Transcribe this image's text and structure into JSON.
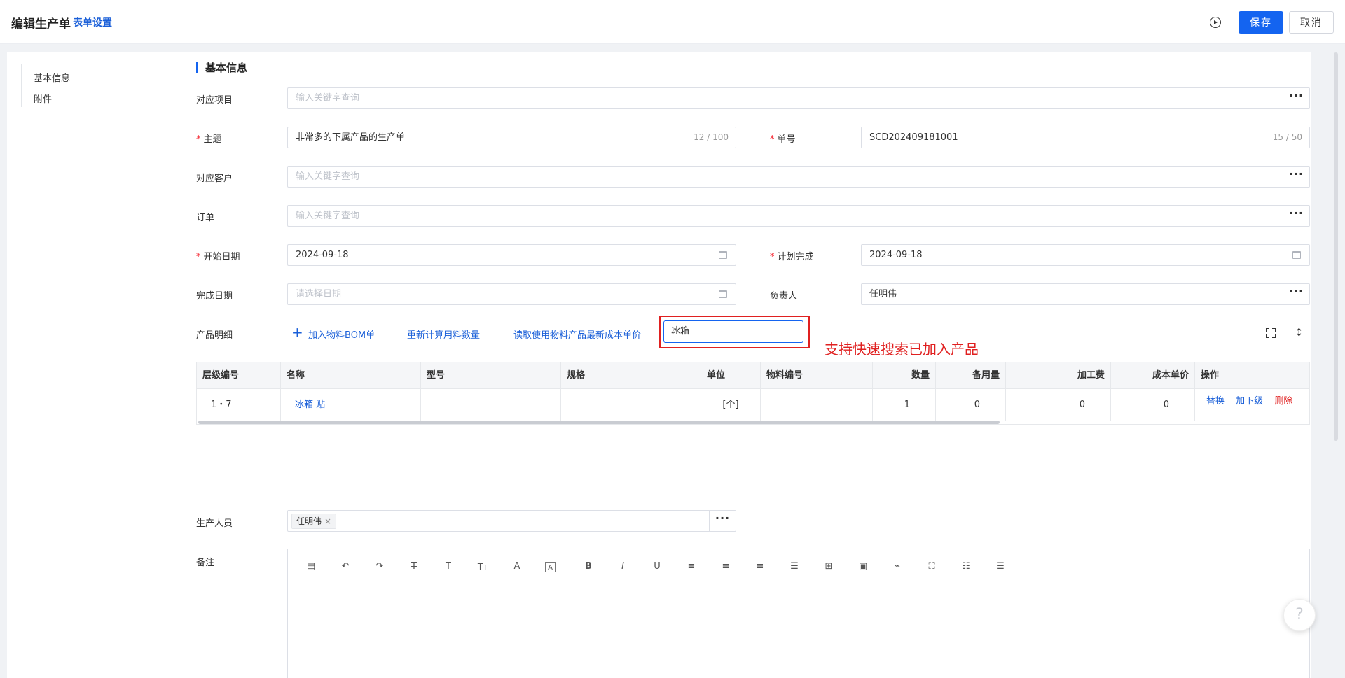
{
  "header": {
    "title": "编辑生产单",
    "form_settings": "表单设置",
    "save": "保存",
    "cancel": "取消"
  },
  "sidebar": {
    "items": [
      {
        "label": "基本信息"
      },
      {
        "label": "附件"
      }
    ]
  },
  "section": {
    "title": "基本信息"
  },
  "form": {
    "project": {
      "label": "对应项目",
      "placeholder": "输入关键字查询"
    },
    "subject": {
      "label": "主题",
      "value": "非常多的下属产品的生产单",
      "count": "12 / 100"
    },
    "number": {
      "label": "单号",
      "value": "SCD202409181001",
      "count": "15 / 50"
    },
    "customer": {
      "label": "对应客户",
      "placeholder": "输入关键字查询"
    },
    "order": {
      "label": "订单",
      "placeholder": "输入关键字查询"
    },
    "start_date": {
      "label": "开始日期",
      "value": "2024-09-18"
    },
    "plan_finish": {
      "label": "计划完成",
      "value": "2024-09-18"
    },
    "finish_date": {
      "label": "完成日期",
      "placeholder": "请选择日期"
    },
    "owner": {
      "label": "负责人",
      "value": "任明伟"
    },
    "product_detail": {
      "label": "产品明细"
    },
    "production_staff": {
      "label": "生产人员",
      "tag": "任明伟"
    },
    "remark": {
      "label": "备注"
    }
  },
  "product_toolbar": {
    "add_bom": "加入物料BOM单",
    "recalc": "重新计算用料数量",
    "read_cost": "读取使用物料产品最新成本单价",
    "search_value": "冰箱"
  },
  "annotation": {
    "text": "支持快速搜索已加入产品"
  },
  "table": {
    "columns": [
      "层级编号",
      "名称",
      "型号",
      "规格",
      "单位",
      "物料编号",
      "数量",
      "备用量",
      "加工费",
      "成本单价",
      "操作"
    ],
    "rows": [
      {
        "level": "1・7",
        "name": "冰箱 贴",
        "model": "",
        "spec": "",
        "unit": "[个]",
        "material_no": "",
        "qty": "1",
        "reserve": "0",
        "process_fee": "0",
        "cost": "0",
        "actions": {
          "replace": "替换",
          "add_child": "加下级",
          "delete": "删除"
        }
      }
    ]
  },
  "editor_toolbar": {
    "icons": [
      "template-icon",
      "undo-icon",
      "redo-icon",
      "strikethrough-icon",
      "text-icon",
      "font-size-icon",
      "font-color-icon",
      "background-color-icon",
      "bold-icon",
      "italic-icon",
      "underline-icon",
      "align-left-icon",
      "align-center-icon",
      "align-right-icon",
      "align-justify-icon",
      "table-icon",
      "image-icon",
      "attachment-icon",
      "fullscreen-icon",
      "ordered-list-icon",
      "unordered-list-icon"
    ]
  },
  "help": {
    "label": "?"
  },
  "colors": {
    "primary": "#1464f0",
    "link": "#1a5fd8",
    "required": "#f5222d",
    "annotation": "#e02020"
  }
}
